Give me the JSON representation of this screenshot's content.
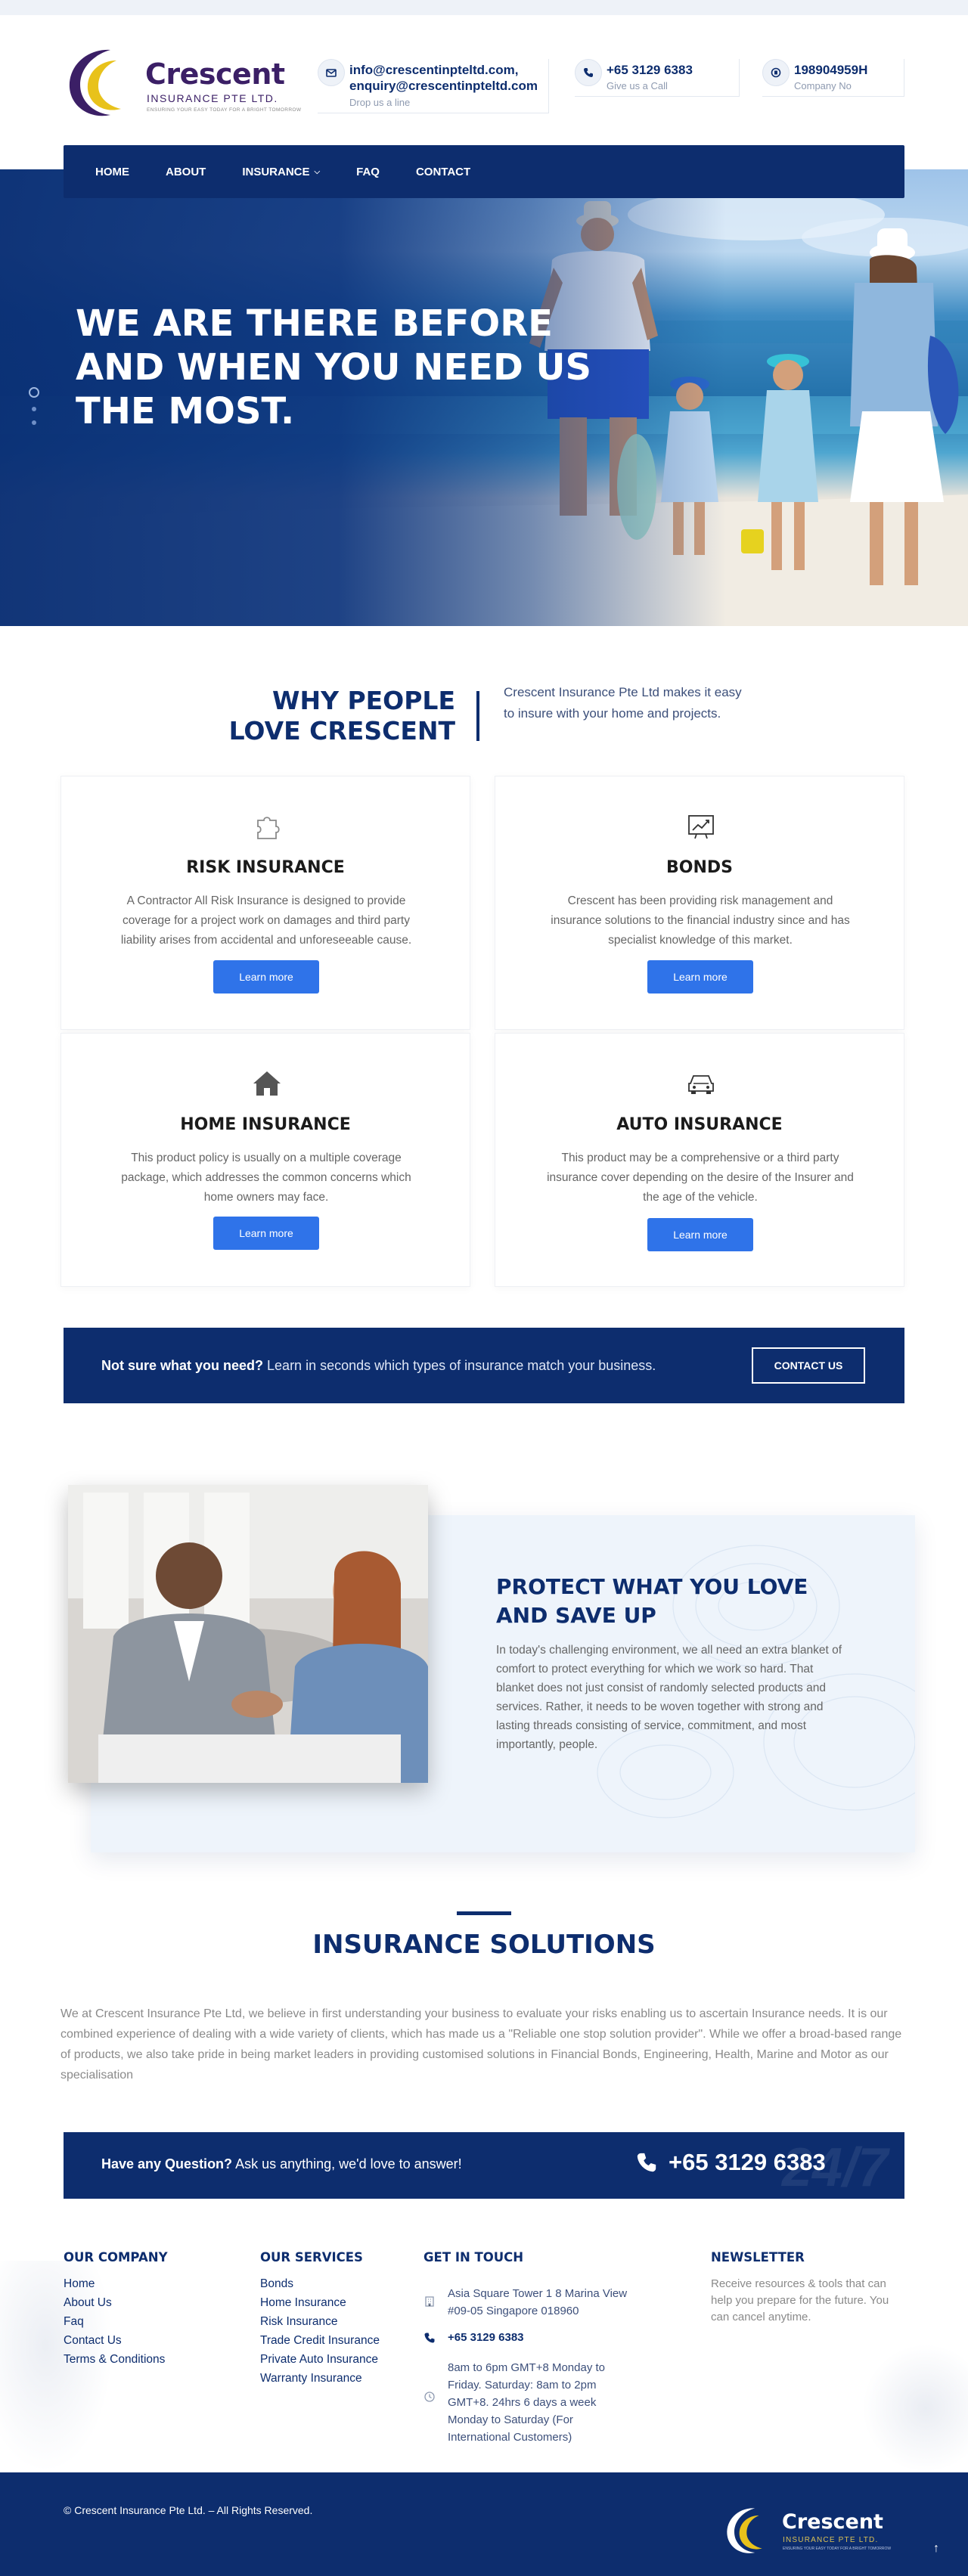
{
  "brand": {
    "name": "Crescent",
    "subtitle": "INSURANCE PTE LTD.",
    "tagline": "ENSURING YOUR EASY TODAY FOR A BRIGHT TOMORROW"
  },
  "header": {
    "email": {
      "line1": "info@crescentinpteltd.com,",
      "line2": "enquiry@crescentinpteltd.com",
      "sub": "Drop us a line",
      "icon": "envelope-icon"
    },
    "phone": {
      "title": "+65 3129 6383",
      "sub": "Give us a Call",
      "icon": "phone-icon"
    },
    "company": {
      "title": "198904959H",
      "sub": "Company No",
      "icon": "building-icon"
    }
  },
  "nav": {
    "items": [
      "HOME",
      "ABOUT",
      "INSURANCE",
      "FAQ",
      "CONTACT"
    ]
  },
  "hero": {
    "title": "WE ARE THERE BEFORE AND WHEN YOU NEED US THE MOST."
  },
  "why": {
    "title_line1": "WHY PEOPLE",
    "title_line2": "LOVE CRESCENT",
    "text": "Crescent Insurance Pte Ltd makes it easy to insure with your home and projects."
  },
  "cards": [
    {
      "title": "RISK INSURANCE",
      "text": "A Contractor All Risk Insurance is designed to provide coverage for a project work on damages and third party liability arises from accidental and unforeseeable cause.",
      "button": "Learn more",
      "icon": "puzzle-icon"
    },
    {
      "title": "BONDS",
      "text": "Crescent has been providing risk management and insurance solutions to the financial industry since and has specialist knowledge of this market.",
      "button": "Learn more",
      "icon": "chart-board-icon"
    },
    {
      "title": "HOME INSURANCE",
      "text": "This product policy is usually on a multiple coverage package, which addresses the common concerns which home owners may face.",
      "button": "Learn more",
      "icon": "home-icon"
    },
    {
      "title": "AUTO INSURANCE",
      "text": "This product may be a comprehensive or a third party insurance cover depending on the desire of the Insurer and the age of the vehicle.",
      "button": "Learn more",
      "icon": "car-icon"
    }
  ],
  "cta_banner": {
    "bold": "Not sure what you need?",
    "text": " Learn in seconds which types of insurance match your business.",
    "button": "CONTACT US"
  },
  "protect": {
    "title": "PROTECT WHAT YOU LOVE AND SAVE UP",
    "text": "In today's challenging environment, we all need an extra blanket of comfort to protect everything for which we work so hard. That blanket does not just consist of randomly selected products and services. Rather, it needs to be woven together with strong and lasting threads consisting of service, commitment, and most importantly, people."
  },
  "solutions": {
    "title": "INSURANCE SOLUTIONS",
    "text": "We at Crescent Insurance Pte Ltd, we believe in first understanding your business to evaluate your risks enabling us to ascertain Insurance needs. It is our combined experience of dealing with a wide variety of clients, which has made us a \"Reliable one stop solution provider\". While we offer a broad-based range of products, we also take pride in being market leaders in providing customised solutions in Financial Bonds, Engineering, Health, Marine and Motor as our specialisation"
  },
  "question": {
    "bold": "Have any Question?",
    "text": " Ask us anything, we'd love to answer!",
    "phone": "+65 3129 6383",
    "watermark": "24/7"
  },
  "footer": {
    "company": {
      "title": "OUR COMPANY",
      "links": [
        "Home",
        "About Us",
        "Faq",
        "Contact Us",
        "Terms & Conditions"
      ]
    },
    "services": {
      "title": "OUR SERVICES",
      "links": [
        "Bonds",
        "Home Insurance",
        "Risk Insurance",
        "Trade Credit Insurance",
        "Private Auto Insurance",
        "Warranty Insurance"
      ]
    },
    "contact": {
      "title": "GET IN TOUCH",
      "address": "Asia Square Tower 1 8 Marina View #09-05 Singapore 018960",
      "phone": "+65 3129 6383",
      "hours": "8am to 6pm GMT+8 Monday to Friday. Saturday: 8am to 2pm GMT+8. 24hrs 6 days a week Monday to Saturday (For International Customers)"
    },
    "newsletter": {
      "title": "NEWSLETTER",
      "text": "Receive resources & tools that can help you prepare for the future. You can cancel anytime."
    }
  },
  "bottom": {
    "copyright": "©  Crescent Insurance Pte Ltd. – All Rights Reserved.",
    "scroll_top": "↑"
  },
  "colors": {
    "navy": "#0d2d6e",
    "button_blue": "#2f73e9",
    "logo_purple": "#3b1f66",
    "logo_gold": "#e8c21b"
  }
}
